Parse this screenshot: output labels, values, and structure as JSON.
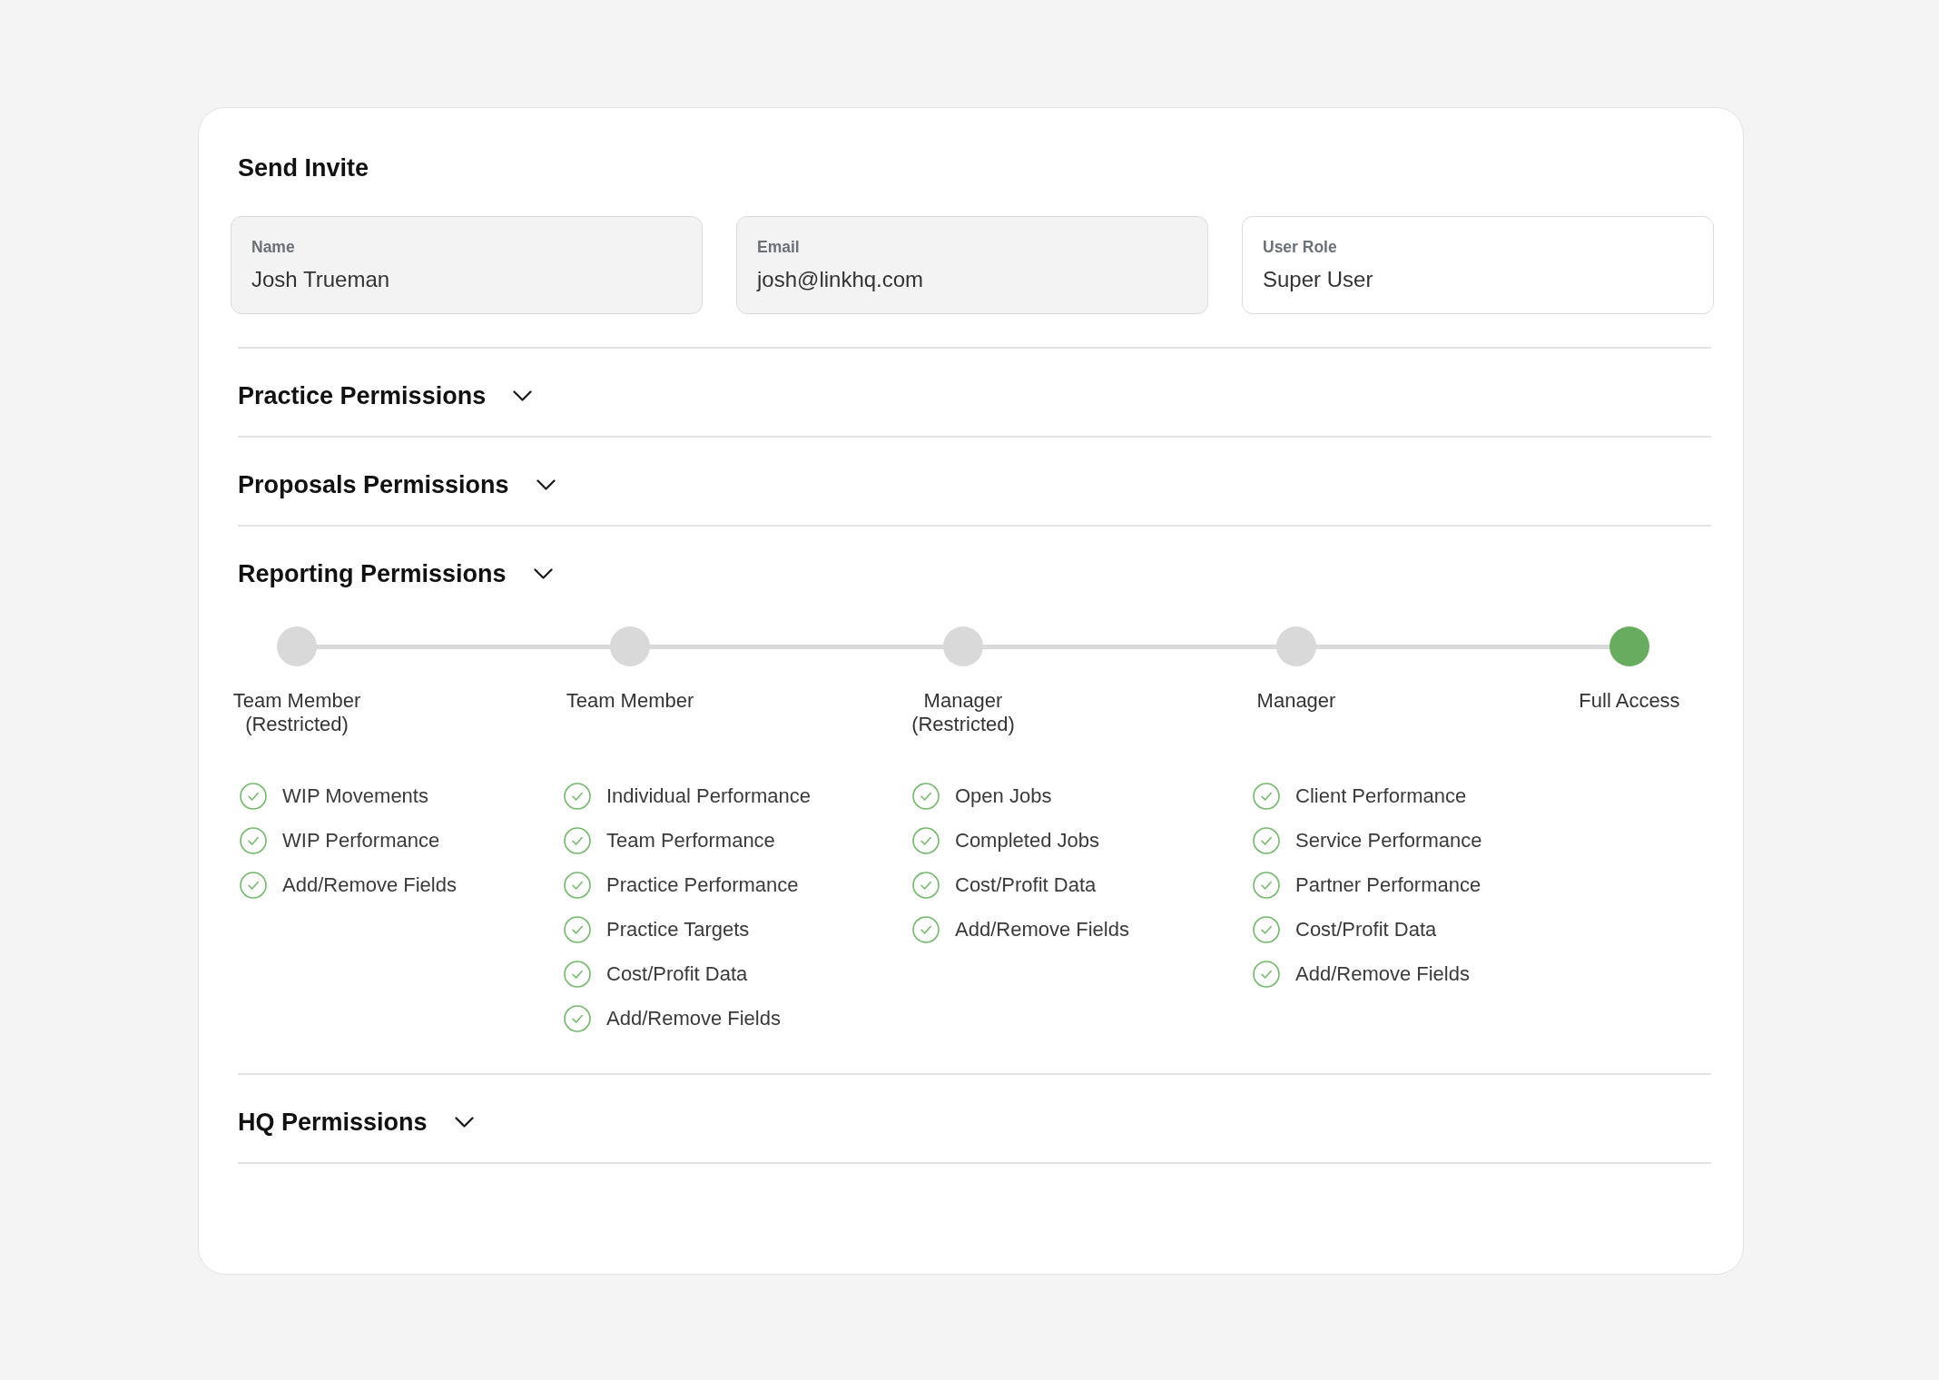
{
  "title": "Send Invite",
  "fields": [
    {
      "label": "Name",
      "value": "Josh Trueman",
      "disabled": true
    },
    {
      "label": "Email",
      "value": "josh@linkhq.com",
      "disabled": true
    },
    {
      "label": "User Role",
      "value": "Super User",
      "disabled": false
    }
  ],
  "sections": [
    {
      "title": "Practice Permissions"
    },
    {
      "title": "Proposals Permissions"
    },
    {
      "title": "Reporting Permissions",
      "access_levels": [
        {
          "label": "Team Member (Restricted)",
          "selected": false
        },
        {
          "label": "Team Member",
          "selected": false
        },
        {
          "label": "Manager (Restricted)",
          "selected": false
        },
        {
          "label": "Manager",
          "selected": false
        },
        {
          "label": "Full Access",
          "selected": true
        }
      ],
      "permission_columns": [
        {
          "items": [
            {
              "label": "WIP Movements",
              "checked": true
            },
            {
              "label": "WIP Performance",
              "checked": true
            },
            {
              "label": "Add/Remove Fields",
              "checked": true
            }
          ]
        },
        {
          "items": [
            {
              "label": "Individual Performance",
              "checked": true
            },
            {
              "label": "Team Performance",
              "checked": true
            },
            {
              "label": "Practice Performance",
              "checked": true
            },
            {
              "label": "Practice Targets",
              "checked": true
            },
            {
              "label": "Cost/Profit Data",
              "checked": true
            },
            {
              "label": "Add/Remove Fields",
              "checked": true
            }
          ]
        },
        {
          "items": [
            {
              "label": "Open Jobs",
              "checked": true
            },
            {
              "label": "Completed Jobs",
              "checked": true
            },
            {
              "label": "Cost/Profit Data",
              "checked": true
            },
            {
              "label": "Add/Remove Fields",
              "checked": true
            }
          ]
        },
        {
          "items": [
            {
              "label": "Client Performance",
              "checked": true
            },
            {
              "label": "Service Performance",
              "checked": true
            },
            {
              "label": "Partner Performance",
              "checked": true
            },
            {
              "label": "Cost/Profit Data",
              "checked": true
            },
            {
              "label": "Add/Remove Fields",
              "checked": true
            }
          ]
        }
      ]
    },
    {
      "title": "HQ Permissions"
    }
  ]
}
